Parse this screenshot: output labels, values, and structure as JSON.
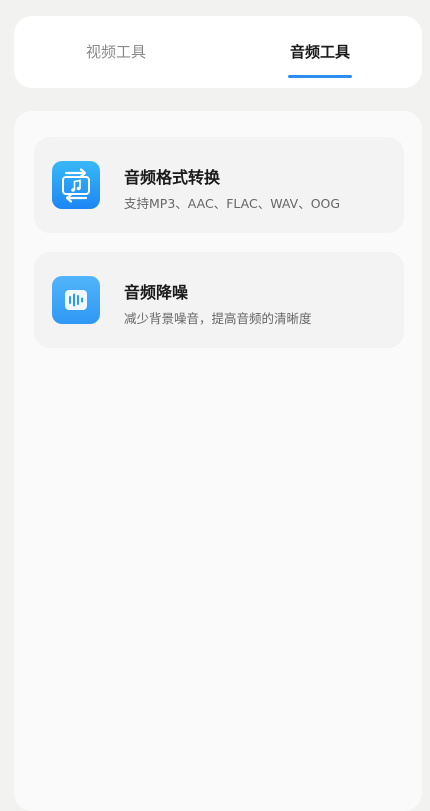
{
  "tabs": {
    "video_label": "视频工具",
    "audio_label": "音频工具",
    "active": "音频工具"
  },
  "tools": [
    {
      "title": "音频格式转换",
      "subtitle": "支持MP3、AAC、FLAC、WAV、OOG",
      "icon": "audio-convert-icon"
    },
    {
      "title": "音频降噪",
      "subtitle": "减少背景噪音，提高音频的清晰度",
      "icon": "audio-denoise-icon"
    }
  ],
  "colors": {
    "accent": "#2e8df2",
    "background": "#f2f2f0"
  }
}
